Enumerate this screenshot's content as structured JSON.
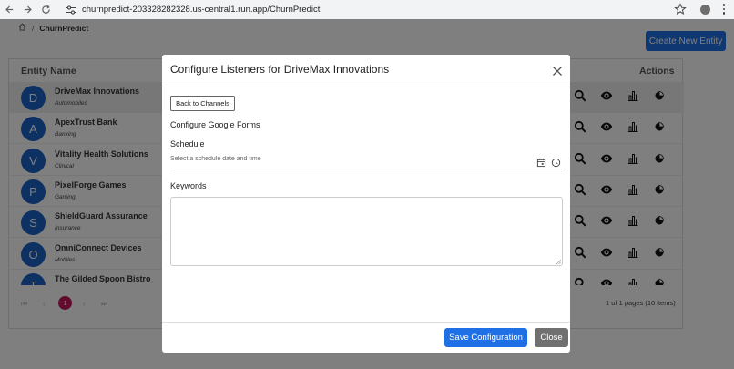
{
  "browser": {
    "url": "churnpredict-203328282328.us-central1.run.app/ChurnPredict",
    "icons": [
      "back-arrow-icon",
      "forward-arrow-icon",
      "reload-icon",
      "tune-icon",
      "star-icon",
      "profile-icon",
      "kebab-menu-icon"
    ]
  },
  "breadcrumb": {
    "current": "ChurnPredict",
    "separator": "/"
  },
  "header": {
    "create_label": "Create New Entity"
  },
  "table": {
    "col_name": "Entity Name",
    "col_actions": "Actions",
    "rows": [
      {
        "initial": "D",
        "name": "DriveMax Innovations",
        "industry": "Automobiles",
        "selected": true
      },
      {
        "initial": "A",
        "name": "ApexTrust Bank",
        "industry": "Banking"
      },
      {
        "initial": "V",
        "name": "Vitality Health Solutions",
        "industry": "Clinical"
      },
      {
        "initial": "P",
        "name": "PixelForge Games",
        "industry": "Gaming"
      },
      {
        "initial": "S",
        "name": "ShieldGuard Assurance",
        "industry": "Insurance"
      },
      {
        "initial": "O",
        "name": "OmniConnect Devices",
        "industry": "Mobiles"
      },
      {
        "initial": "T",
        "name": "The Gilded Spoon Bistro",
        "industry": ""
      }
    ],
    "action_icons": [
      "search-icon",
      "eye-icon",
      "bar-chart-icon",
      "pie-chart-icon"
    ]
  },
  "pager": {
    "first": "⏮",
    "prev": "‹",
    "current_page": "1",
    "next": "›",
    "last": "⏭",
    "summary": "1 of 1 pages (10 items)"
  },
  "modal": {
    "title": "Configure Listeners for DriveMax Innovations",
    "back_label": "Back to Channels",
    "subtitle": "Configure Google Forms",
    "schedule_label": "Schedule",
    "schedule_placeholder": "Select a schedule date and time",
    "keywords_label": "Keywords",
    "keywords_value": "",
    "save_label": "Save Configuration",
    "close_label": "Close"
  },
  "colors": {
    "primary": "#1f6fe5",
    "avatar": "#1c63c7",
    "page_active": "#c2185b",
    "close_button": "#707070"
  }
}
